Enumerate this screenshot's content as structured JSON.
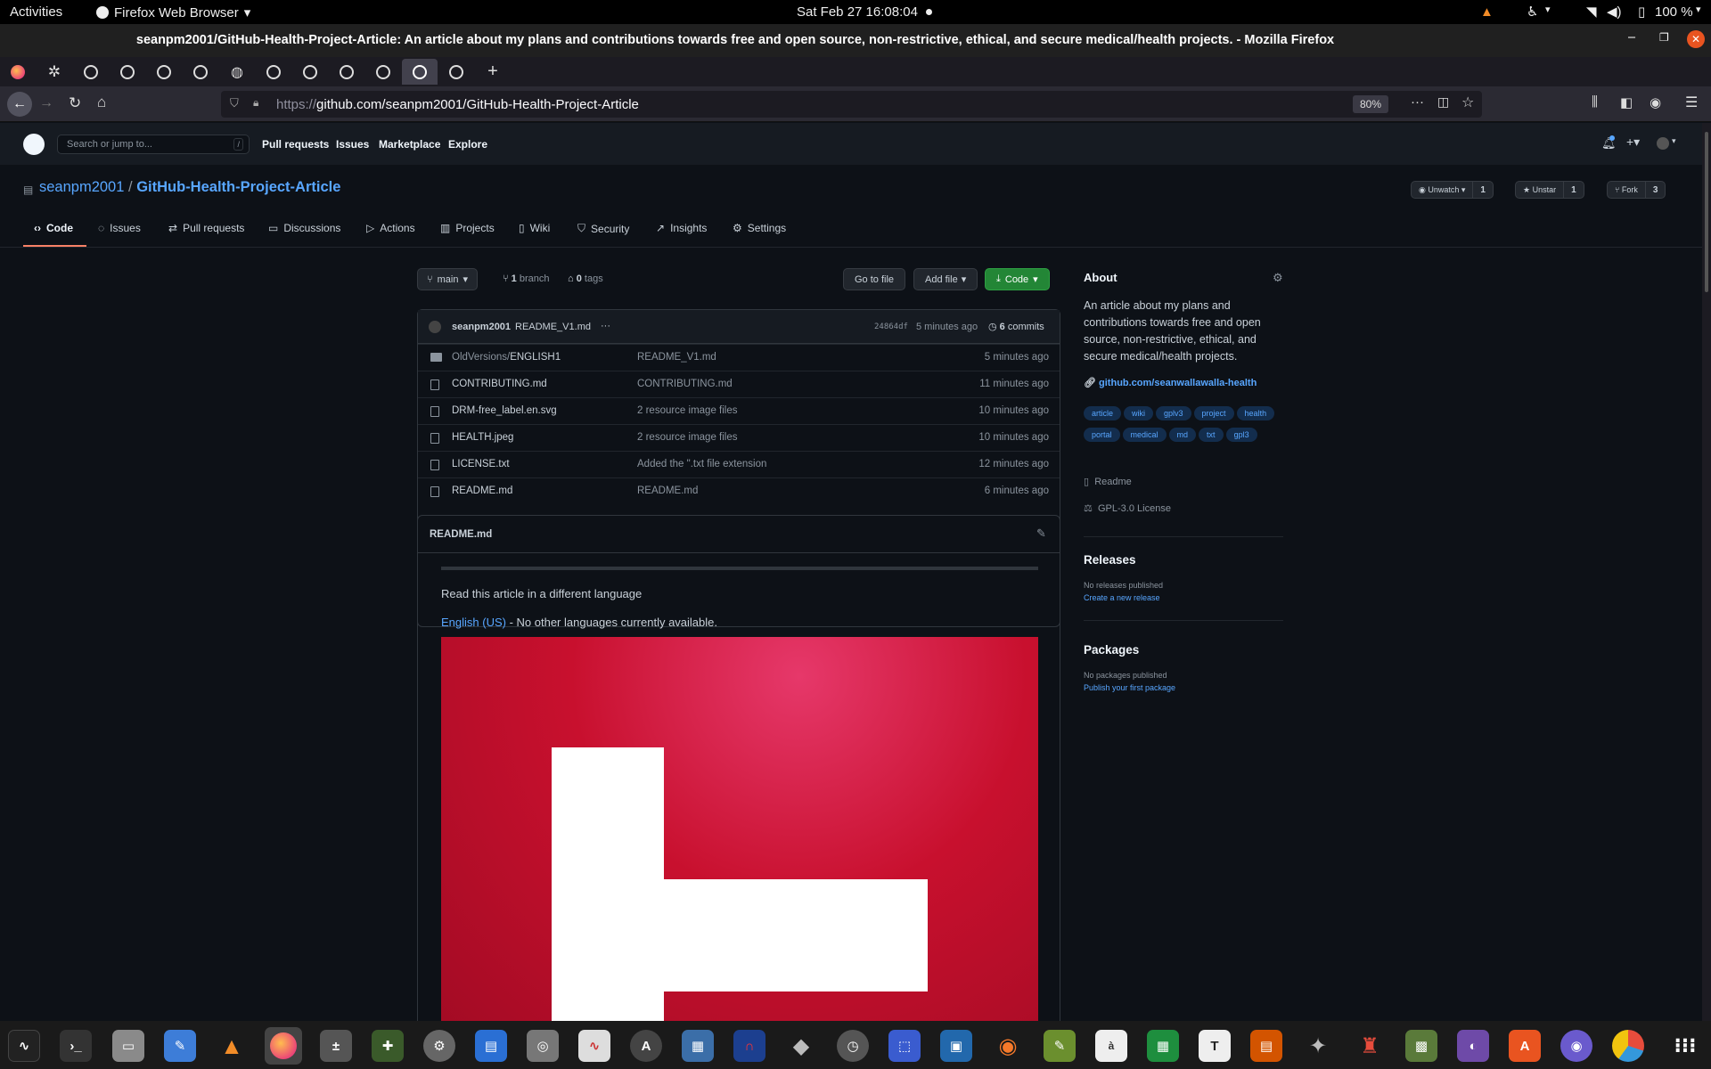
{
  "topbar": {
    "activities": "Activities",
    "app": "Firefox Web Browser",
    "datetime": "Sat Feb 27  16:08:04",
    "battery": "100 %"
  },
  "window": {
    "title": "seanpm2001/GitHub-Health-Project-Article: An article about my plans and contributions towards free and open source, non-restrictive, ethical, and secure medical/health projects. - Mozilla Firefox"
  },
  "browser": {
    "url_prefix": "https://",
    "url_domain": "github.com",
    "url_path": "/seanpm2001/GitHub-Health-Project-Article",
    "zoom": "80%"
  },
  "gh": {
    "search_placeholder": "Search or jump to...",
    "search_key": "/",
    "nav": [
      "Pull requests",
      "Issues",
      "Marketplace",
      "Explore"
    ]
  },
  "repo": {
    "owner": "seanpm2001",
    "sep": "/",
    "name": "GitHub-Health-Project-Article",
    "unwatch": "Unwatch",
    "watch_count": "1",
    "unstar": "Unstar",
    "star_count": "1",
    "fork": "Fork",
    "fork_count": "3",
    "tabs": [
      "Code",
      "Issues",
      "Pull requests",
      "Discussions",
      "Actions",
      "Projects",
      "Wiki",
      "Security",
      "Insights",
      "Settings"
    ],
    "branch": "main",
    "branch_count": "1",
    "branch_label": "branch",
    "tag_count": "0",
    "tag_label": "tags",
    "goto": "Go to file",
    "addfile": "Add file",
    "code": "Code"
  },
  "commit": {
    "author": "seanpm2001",
    "message": "README_V1.md",
    "more": "···",
    "sha": "24864df",
    "time": "5 minutes ago",
    "count": "6",
    "count_label": "commits"
  },
  "files": [
    {
      "name_dim": "OldVersions/",
      "name": "ENGLISH1",
      "msg": "README_V1.md",
      "age": "5 minutes ago"
    },
    {
      "name": "CONTRIBUTING.md",
      "msg": "CONTRIBUTING.md",
      "age": "11 minutes ago"
    },
    {
      "name": "DRM-free_label.en.svg",
      "msg": "2 resource image files",
      "age": "10 minutes ago"
    },
    {
      "name": "HEALTH.jpeg",
      "msg": "2 resource image files",
      "age": "10 minutes ago"
    },
    {
      "name": "LICENSE.txt",
      "msg": "Added the \".txt file extension",
      "age": "12 minutes ago"
    },
    {
      "name": "README.md",
      "msg": "README.md",
      "age": "6 minutes ago"
    }
  ],
  "readme": {
    "title": "README.md",
    "line1": "Read this article in a different language",
    "link": "English (US)",
    "line2": " - No other languages currently available."
  },
  "about": {
    "heading": "About",
    "desc": "An article about my plans and contributions towards free and open source, non-restrictive, ethical, and secure medical/health projects.",
    "link": "github.com/seanwallawalla-health",
    "topics": [
      "article",
      "wiki",
      "gplv3",
      "project",
      "health",
      "portal",
      "medical",
      "md",
      "txt",
      "gpl3"
    ],
    "readme": "Readme",
    "license": "GPL-3.0 License"
  },
  "releases": {
    "heading": "Releases",
    "none": "No releases published",
    "create": "Create a new release"
  },
  "packages": {
    "heading": "Packages",
    "none": "No packages published",
    "publish": "Publish your first package"
  },
  "colors": {
    "accent": "#58a6ff",
    "green": "#238636",
    "tab_underline": "#f78166",
    "health_red": "#c8102e"
  }
}
